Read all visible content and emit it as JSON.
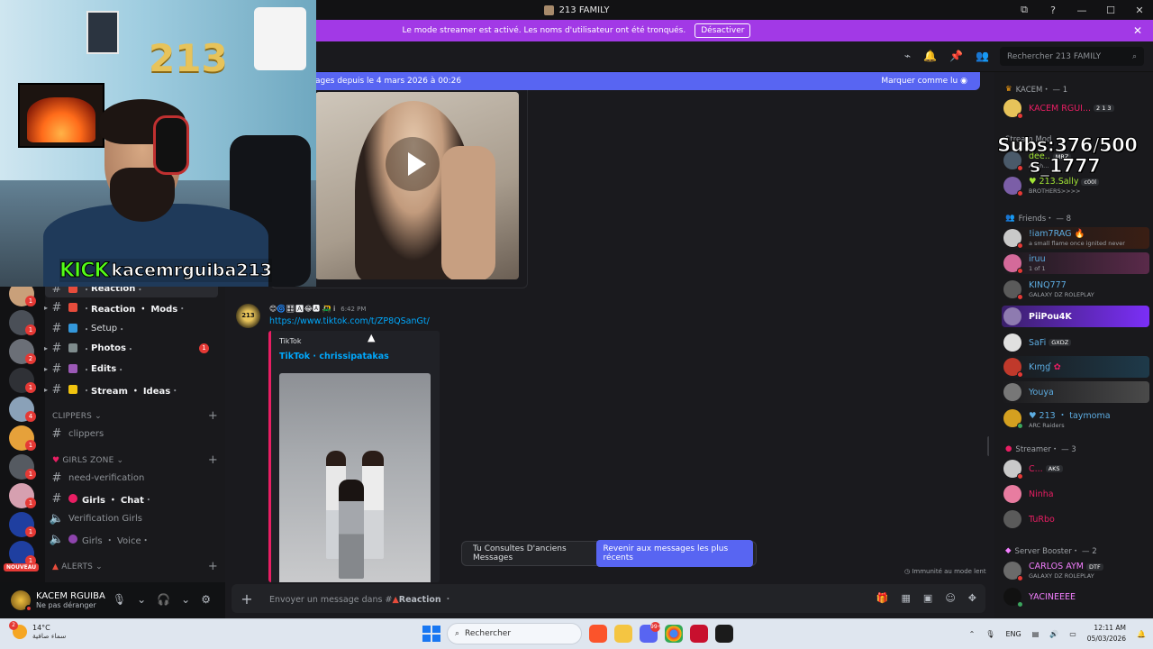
{
  "window": {
    "title": "213 FAMILY",
    "controls": [
      "⧉",
      "?",
      "—",
      "☐",
      "✕"
    ]
  },
  "banner": {
    "text": "Le mode streamer est activé. Les noms d'utilisateur ont été tronqués.",
    "button": "Désactiver",
    "close": "✕"
  },
  "header": {
    "back": "‹",
    "search_placeholder": "Rechercher 213 FAMILY"
  },
  "new_messages": {
    "text": "ages depuis le 4 mars 2026 à 00:26",
    "mark_read": "Marquer comme lu"
  },
  "overlay": {
    "kick_logo": "KICK",
    "kick_name": "kacemrguiba213",
    "balloon_text": "213",
    "subs_line1": "Subs:376/500",
    "subs_line2": "s_1777"
  },
  "rail": {
    "badges": [
      "1",
      "1",
      "2",
      "1",
      "4",
      "1",
      "1",
      "1",
      "1",
      "1"
    ],
    "nouveau": "NOUVEAU"
  },
  "channels": {
    "items": [
      {
        "label": "Reaction",
        "prefix": "・",
        "suffix": " ・",
        "emoji_color": "#e74c3c"
      },
      {
        "label": "Reaction ・ Mods",
        "prefix": "・",
        "suffix": " ・",
        "emoji_color": "#e74c3c"
      },
      {
        "label": "Setup",
        "prefix": "・",
        "suffix": " ・",
        "emoji_color": "#3498db"
      },
      {
        "label": "Photos",
        "prefix": "・",
        "suffix": " ・",
        "emoji_color": "#7f8c8d",
        "count": "1"
      },
      {
        "label": "Edits",
        "prefix": "・",
        "suffix": " ・",
        "emoji_color": "#9b59b6"
      },
      {
        "label": "Stream ・ Ideas",
        "prefix": "・",
        "suffix": " ・",
        "emoji_color": "#f1c40f"
      }
    ],
    "cat_clippers": "CLIPPERS",
    "clippers": "clippers",
    "cat_girls": "GIRLS ZONE",
    "need_verification": "need-verification",
    "girls_chat": "Girls ・ Chat",
    "verification_girls": "Verification Girls",
    "girls_voice": "Girls ・ Voice",
    "cat_alerts": "ALERTS"
  },
  "user": {
    "name": "KACEM RGUIBA",
    "status": "Ne pas déranger"
  },
  "chat": {
    "msg_author": "😊🌀🎛🅰😂🅰 🛺 i",
    "msg_time": "6:42 PM",
    "msg_link": "https://www.tiktok.com/t/ZP8QSanGt/",
    "embed_provider": "TikTok",
    "embed_title": "TikTok · chrissipatakas",
    "toast_text": "Tu Consultes D'anciens Messages",
    "toast_button": "Revenir aux messages les plus récents",
    "slow_mode": "Immunité au mode lent",
    "avatar_text": "213"
  },
  "composer": {
    "placeholder": "Envoyer un message dans #",
    "channel": "Reaction",
    "channel_suffix": " ・"
  },
  "members": {
    "g1": "KACEM・ — 1",
    "g2": "Stream Mod",
    "g3": "Friends・ — 8",
    "g4": "Streamer・ — 3",
    "g5": "Server Booster・ — 2",
    "rows": [
      {
        "name": "KACEM RGUI...",
        "tag": "2 1 3",
        "color": "#e91e63",
        "act": ""
      },
      {
        "name": "dee..",
        "tag": "MRZ",
        "color": "#a3e635",
        "act": "Allah..."
      },
      {
        "name": "213.Sally",
        "tag": "c00l",
        "color": "#a3e635",
        "act": "BROTHERS>>>>"
      },
      {
        "name": "!iam7RAG",
        "tag": "",
        "color": "#5dade2",
        "act": "a small flame once ignited never"
      },
      {
        "name": "iruu",
        "tag": "",
        "color": "#5dade2",
        "act": "1 of 1"
      },
      {
        "name": "KINQ777",
        "tag": "",
        "color": "#5dade2",
        "act": "GALAXY DZ ROLEPLAY"
      },
      {
        "name": "PiiPou4K",
        "tag": "",
        "color": "#ffffff",
        "act": ""
      },
      {
        "name": "SaFi",
        "tag": "GXDZ",
        "color": "#5dade2",
        "act": ""
      },
      {
        "name": "Kıɱɠ",
        "tag": "",
        "color": "#5dade2",
        "act": ""
      },
      {
        "name": "Youya",
        "tag": "",
        "color": "#5dade2",
        "act": ""
      },
      {
        "name": "213 ・ taymoma",
        "tag": "",
        "color": "#5dade2",
        "act": "ARC Raiders"
      },
      {
        "name": "C...",
        "tag": "AKS",
        "color": "#e91e63",
        "act": ""
      },
      {
        "name": "Ninha",
        "tag": "",
        "color": "#e91e63",
        "act": ""
      },
      {
        "name": "TuRbo",
        "tag": "",
        "color": "#e91e63",
        "act": ""
      },
      {
        "name": "CARLOS AYM",
        "tag": "DTF",
        "color": "#f47fff",
        "act": "GALAXY DZ ROLEPLAY"
      },
      {
        "name": "YACINEEEE",
        "tag": "",
        "color": "#f47fff",
        "act": ""
      }
    ]
  },
  "taskbar": {
    "temp": "14°C",
    "weather": "سماء صافية",
    "weather_badge": "2",
    "search": "Rechercher",
    "discord_badge": "99+",
    "lang": "ENG",
    "time": "12:11 AM",
    "date": "05/03/2026"
  }
}
